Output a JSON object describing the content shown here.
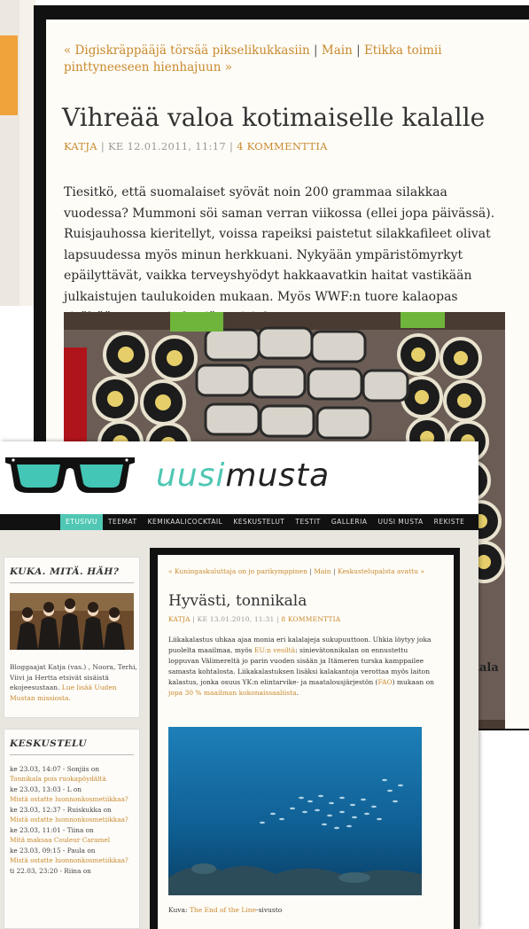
{
  "back_article": {
    "nav_prev": "« Digiskräppääjä törsää pikselikukkasiin",
    "nav_main": "Main",
    "nav_next": "Etikka toimii pinttyneeseen hienhajuun »",
    "nav_sep": "|",
    "title": "Vihreää valoa kotimaiselle kalalle",
    "author": "KATJA",
    "date": "KE 12.01.2011, 11:17",
    "comments": "4 KOMMENTTIA",
    "meta_sep": "|",
    "body": "Tiesitkö, että suomalaiset syövät noin 200 grammaa silakkaa vuodessa? Mummoni söi saman verran viikossa (ellei jopa päivässä). Ruisjauhossa kieritellyt, voissa rapeiksi paistetut silakkafileet olivat lapsuudessa myös minun herkkuani. Nykyään ympäristömyrkyt epäilyttävät, vaikka terveyshyödyt hakkaavatkin haitat vastikään julkaistujen taulukoiden mukaan. Myös WWF:n tuore kalaopas sisältää muutamia hyviä uutisia!",
    "caption_fragment": "kala"
  },
  "site": {
    "logo_uusi": "uusi",
    "logo_musta": "musta",
    "nav": [
      "ETUSIVU",
      "TEEMAT",
      "KEMIKAALICOCKTAIL",
      "KESKUSTELUT",
      "TESTIT",
      "GALLERIA",
      "UUSI MUSTA",
      "REKISTE"
    ]
  },
  "sidebar": {
    "about_title": "KUKA. MITÄ. HÄH?",
    "about_text": "Bloggaajat Katja (vas.) , Noora, Terhi, Viivi ja Hertta etsivät sisäistä ekojeesustaan.",
    "about_link": "Lue lisää Uuden Mustan missiosta.",
    "discussion_title": "KESKUSTELU",
    "discussions": [
      {
        "meta": "ke 23.03, 14:07 - Sonjiis on",
        "link": "Tonnikala pois ruokapöydältä"
      },
      {
        "meta": "ke 23.03, 13:03 - L on",
        "link": "Mistä ostatte luonnonkosmetiikkaa?"
      },
      {
        "meta": "ke 23.03, 12:37 - Ruiskukka on",
        "link": "Mistä ostatte luonnonkosmetiikkaa?"
      },
      {
        "meta": "ke 23.03, 11:01 - Tiina on",
        "link": "Mitä maksaa Couleur Caramel"
      },
      {
        "meta": "ke 23.03, 09:15 - Paula on",
        "link": "Mistä ostatte luonnonkosmetiikkaa?"
      },
      {
        "meta": "ti 22.03, 23:20 - Riina on",
        "link": ""
      }
    ]
  },
  "main_article": {
    "nav_prev": "« Kuningaskuluttaja on jo parikymppinen",
    "nav_main": "Main",
    "nav_next": "Keskustelupalsta avattu »",
    "nav_sep": "|",
    "title": "Hyvästi, tonnikala",
    "author": "KATJA",
    "date": "KE 13.01.2010, 11:31",
    "comments": "8 KOMMENTTIA",
    "meta_sep": "|",
    "body_1": "Liikakalastus uhkaa ajaa monia eri kalalajeja sukupuuttoon. Uhkia löytyy joka puolelta maailmaa, myös ",
    "link_eu": "EU:n vesiltä",
    "body_2": ": sinievätonnikalan on ennustettu loppuvan Välimereltä jo parin vuoden sisään ja Itämeren turska kamppailee samasta kohtalosta. Liikakalastuksen lisäksi kalakantoja verottaa myös laiton kalastus, jonka osuus YK:n elintarvike- ja maatalousjärjestön (",
    "link_fao": "FAO",
    "body_3": ") mukaan on ",
    "link_share": "jopa 30 % maailman kokonaissaaliista",
    "body_4": ".",
    "caption_label": "Kuva: ",
    "caption_link": "The End of the Line",
    "caption_suffix": "-sivusto"
  },
  "colors": {
    "accent": "#4fc7b4",
    "link": "#c88a2e",
    "frame": "#111111"
  }
}
